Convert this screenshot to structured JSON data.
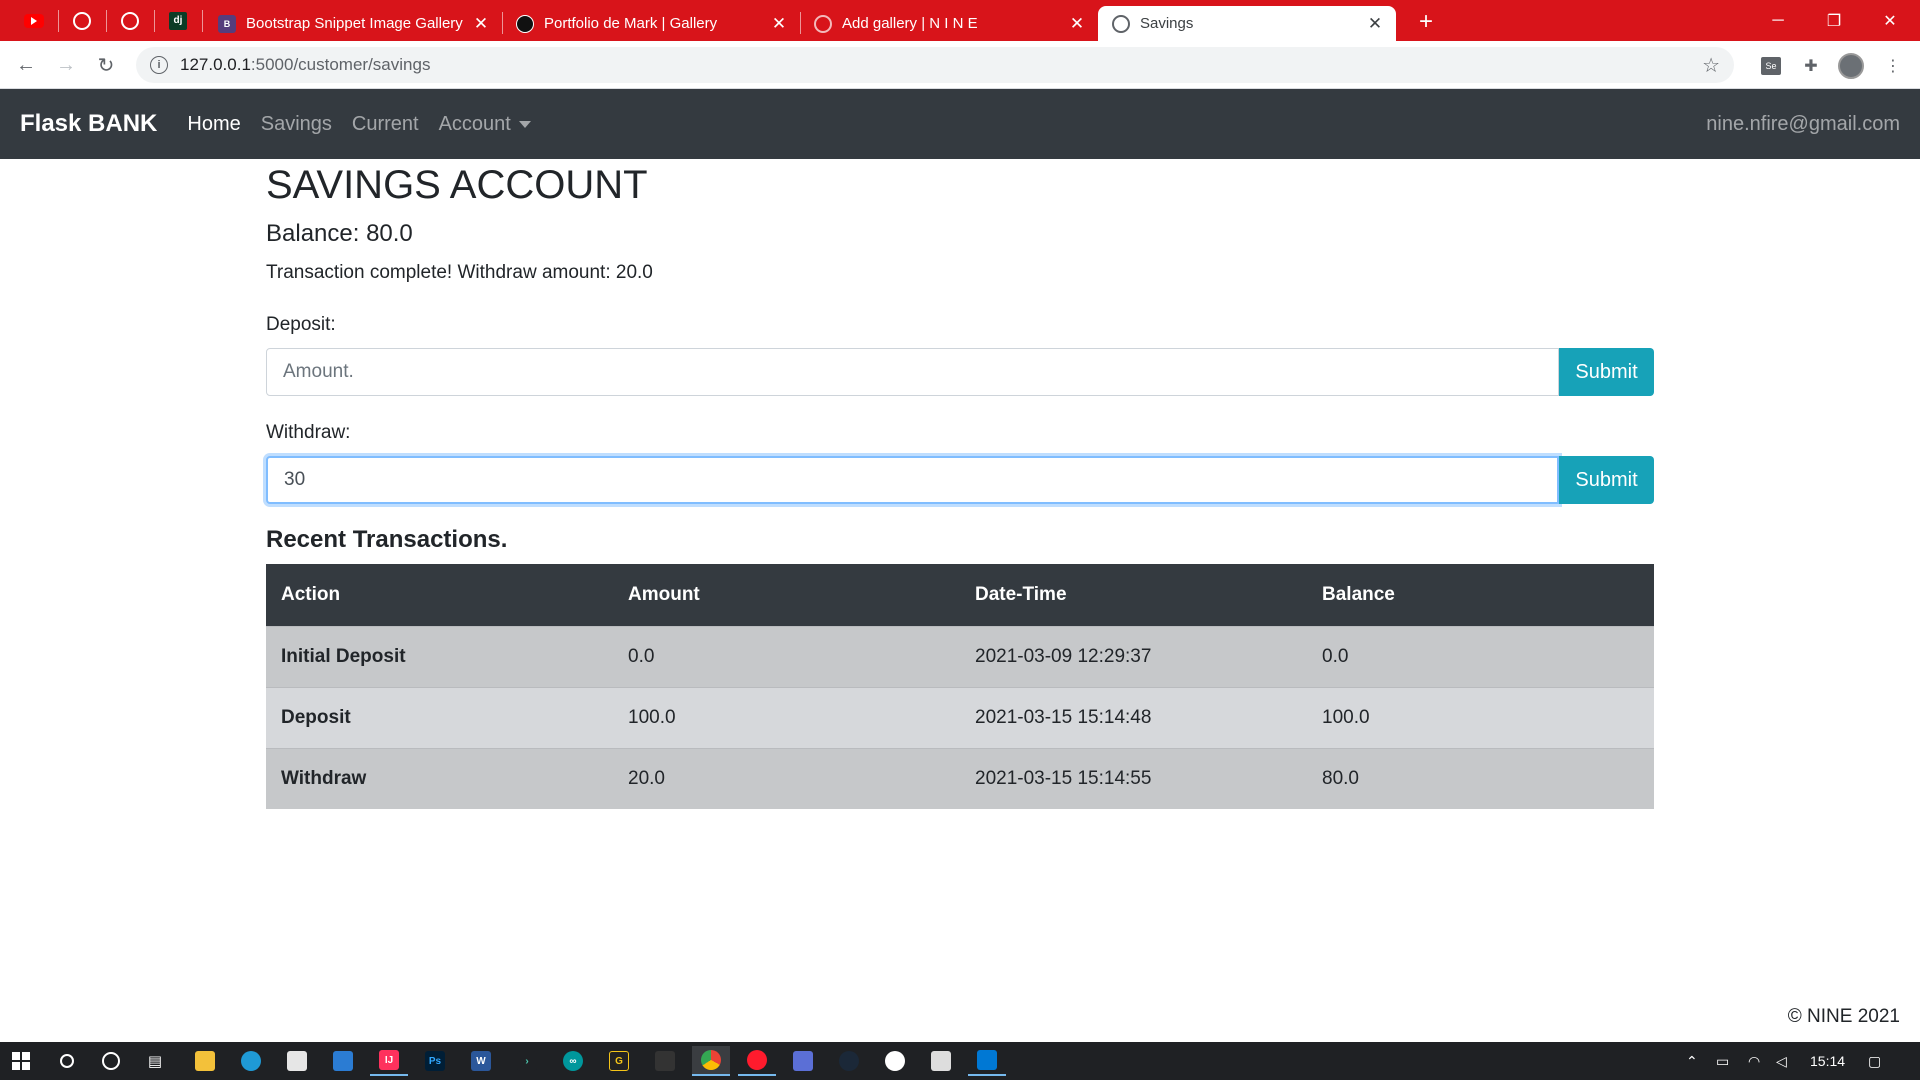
{
  "browser": {
    "tabs": [
      {
        "title": "Bootstrap Snippet Image Gallery",
        "icon": "bootstrap-favicon-icon",
        "active": false
      },
      {
        "title": "Portfolio de Mark | Gallery",
        "icon": "portfolio-favicon-icon",
        "active": false
      },
      {
        "title": "Add gallery | N I N E",
        "icon": "globe-favicon-icon",
        "active": false
      },
      {
        "title": "Savings",
        "icon": "globe-favicon-icon",
        "active": true
      }
    ],
    "pinned_tabs": [
      "youtube-icon",
      "github-icon",
      "github-icon",
      "django-icon"
    ],
    "pinned_django_label": "dj",
    "url_host": "127.0.0.1",
    "url_path": ":5000/customer/savings",
    "accent": "#d8141a"
  },
  "app": {
    "brand": "Flask BANK",
    "nav": {
      "home": "Home",
      "savings": "Savings",
      "current": "Current",
      "account": "Account"
    },
    "user_email": "nine.nfire@gmail.com"
  },
  "page": {
    "title": "SAVINGS ACCOUNT",
    "balance": "Balance: 80.0",
    "message": "Transaction complete! Withdraw amount: 20.0",
    "deposit": {
      "label": "Deposit:",
      "placeholder": "Amount.",
      "button": "Submit"
    },
    "withdraw": {
      "label": "Withdraw:",
      "value": "30",
      "button": "Submit"
    },
    "transactions_heading": "Recent Transactions.",
    "table": {
      "headers": [
        "Action",
        "Amount",
        "Date-Time",
        "Balance"
      ],
      "rows": [
        [
          "Initial Deposit",
          "0.0",
          "2021-03-09 12:29:37",
          "0.0"
        ],
        [
          "Deposit",
          "100.0",
          "2021-03-15 15:14:48",
          "100.0"
        ],
        [
          "Withdraw",
          "20.0",
          "2021-03-15 15:14:55",
          "80.0"
        ]
      ]
    },
    "footer": "© NINE 2021",
    "button_color": "#17a2b8",
    "navbar_color": "#343a40"
  },
  "taskbar": {
    "time": "15:14",
    "apps": [
      "file-explorer-icon",
      "edge-icon",
      "store-icon",
      "mail-icon",
      "intellij-icon",
      "photoshop-icon",
      "word-icon",
      "terminal-icon",
      "arduino-icon",
      "g-app-icon",
      "unity-icon",
      "chrome-icon",
      "opera-icon",
      "cube-icon",
      "steam-icon",
      "slack-icon",
      "git-icon",
      "vscode-icon"
    ],
    "app_labels": {
      "intellij": "IJ",
      "photoshop": "Ps",
      "word": "W",
      "g_app": "G"
    }
  }
}
